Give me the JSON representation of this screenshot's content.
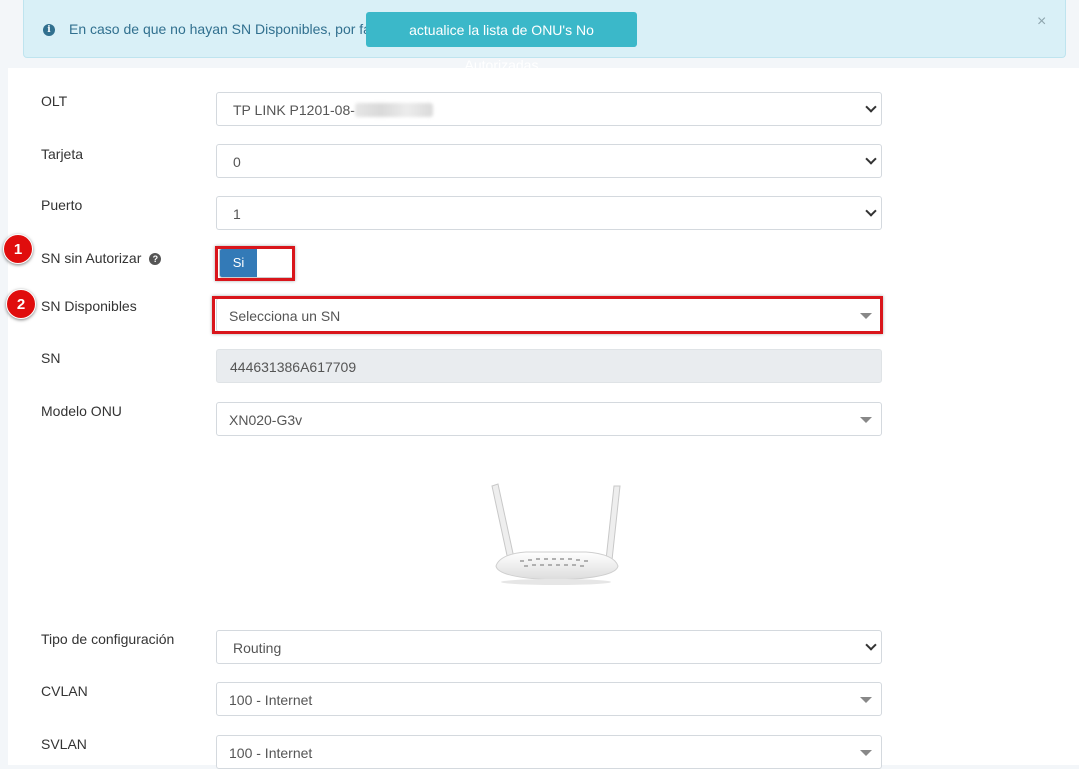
{
  "alert": {
    "message": "En caso de que no hayan SN Disponibles, por favor",
    "action_label": "actualice la lista de ONU's No Autorizadas",
    "close_label": "×"
  },
  "form": {
    "olt": {
      "label": "OLT",
      "value": "TP LINK P1201-08-"
    },
    "tarjeta": {
      "label": "Tarjeta",
      "value": "0"
    },
    "puerto": {
      "label": "Puerto",
      "value": "1"
    },
    "sn_sin_autorizar": {
      "label": "SN sin Autorizar",
      "toggle_label": "Si",
      "toggle_on": true
    },
    "sn_disponibles": {
      "label": "SN Disponibles",
      "placeholder": "Selecciona un SN"
    },
    "sn": {
      "label": "SN",
      "value": "444631386A617709"
    },
    "modelo_onu": {
      "label": "Modelo ONU",
      "value": "XN020-G3v"
    },
    "tipo_config": {
      "label": "Tipo de configuración",
      "value": "Routing"
    },
    "cvlan": {
      "label": "CVLAN",
      "value": "100 - Internet"
    },
    "svlan": {
      "label": "SVLAN",
      "value": "100 - Internet"
    }
  },
  "annotations": {
    "badge_1": "1",
    "badge_2": "2"
  },
  "colors": {
    "alert_bg": "#d9f0f7",
    "alert_button": "#3bb8c9",
    "toggle_on": "#337ab7",
    "highlight": "#d9151b"
  }
}
